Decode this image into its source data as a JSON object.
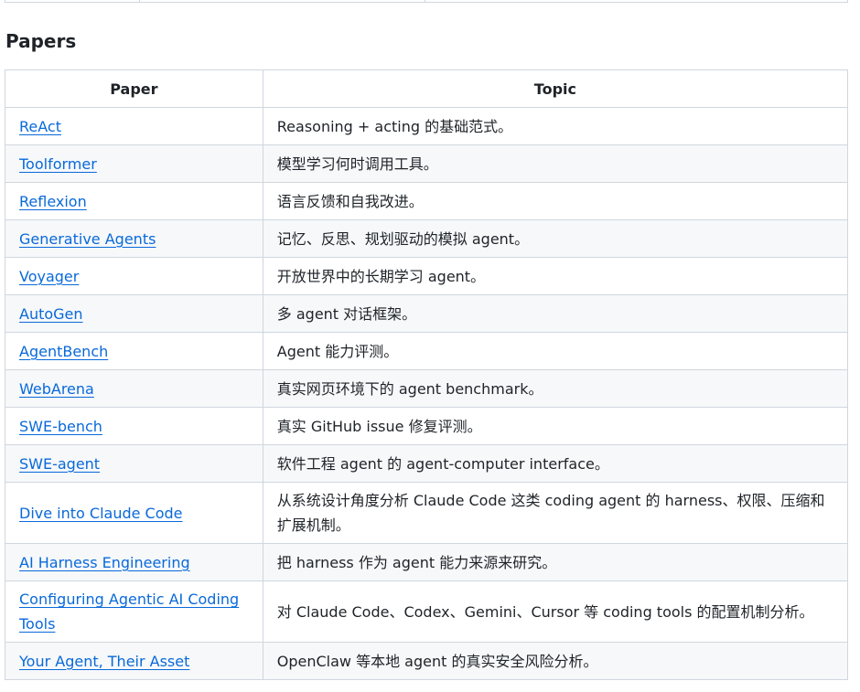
{
  "section_title": "Papers",
  "table": {
    "headers": [
      "Paper",
      "Topic"
    ],
    "rows": [
      {
        "paper": "ReAct",
        "topic": "Reasoning + acting 的基础范式。"
      },
      {
        "paper": "Toolformer",
        "topic": "模型学习何时调用工具。"
      },
      {
        "paper": "Reflexion",
        "topic": "语言反馈和自我改进。"
      },
      {
        "paper": "Generative Agents",
        "topic": "记忆、反思、规划驱动的模拟 agent。"
      },
      {
        "paper": "Voyager",
        "topic": "开放世界中的长期学习 agent。"
      },
      {
        "paper": "AutoGen",
        "topic": "多 agent 对话框架。"
      },
      {
        "paper": "AgentBench",
        "topic": "Agent 能力评测。"
      },
      {
        "paper": "WebArena",
        "topic": "真实网页环境下的 agent benchmark。"
      },
      {
        "paper": "SWE-bench",
        "topic": "真实 GitHub issue 修复评测。"
      },
      {
        "paper": "SWE-agent",
        "topic": "软件工程 agent 的 agent-computer interface。"
      },
      {
        "paper": "Dive into Claude Code",
        "topic": "从系统设计角度分析 Claude Code 这类 coding agent 的 harness、权限、压缩和扩展机制。"
      },
      {
        "paper": "AI Harness Engineering",
        "topic": "把 harness 作为 agent 能力来源来研究。"
      },
      {
        "paper": "Configuring Agentic AI Coding Tools",
        "topic": "对 Claude Code、Codex、Gemini、Cursor 等 coding tools 的配置机制分析。"
      },
      {
        "paper": "Your Agent, Their Asset",
        "topic": "OpenClaw 等本地 agent 的真实安全风险分析。"
      }
    ]
  },
  "colors": {
    "link": "#0969da",
    "border": "#d0d7de",
    "stripe": "#f6f8fa",
    "text": "#1f2328"
  }
}
